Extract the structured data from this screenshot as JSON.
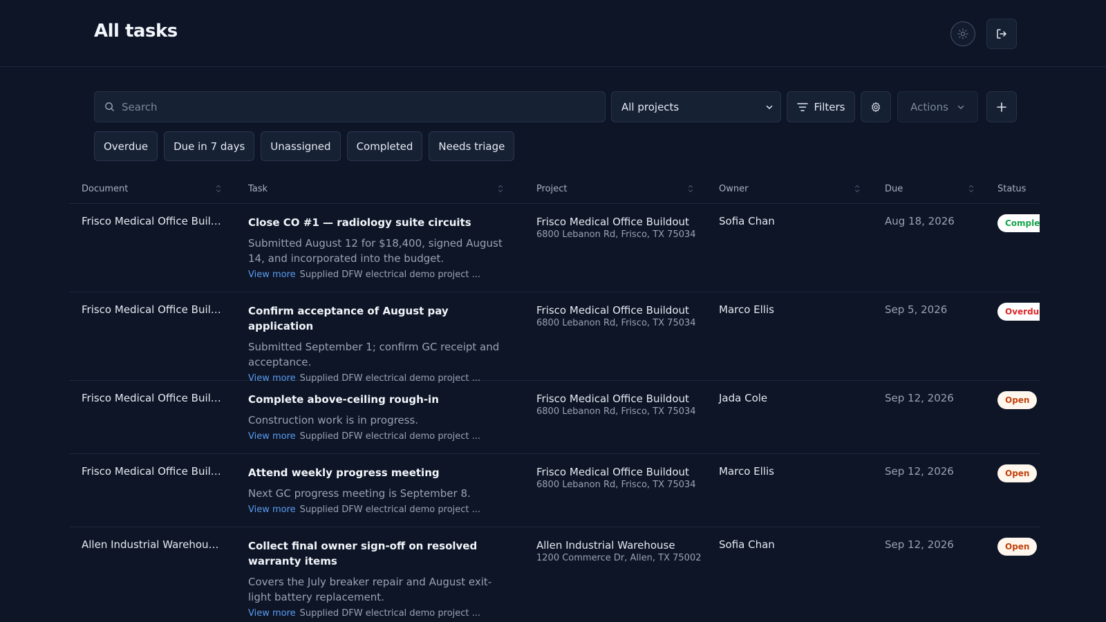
{
  "header": {
    "title": "All tasks",
    "theme_icon": "sun-icon",
    "logout_icon": "logout-icon"
  },
  "toolbar": {
    "search_placeholder": "Search",
    "project_select_value": "All projects",
    "filters_label": "Filters",
    "actions_label": "Actions",
    "settings_icon": "gear-icon",
    "add_icon": "plus-icon"
  },
  "chips": [
    "Overdue",
    "Due in 7 days",
    "Unassigned",
    "Completed",
    "Needs triage"
  ],
  "table": {
    "columns": {
      "document": "Document",
      "task": "Task",
      "project": "Project",
      "owner": "Owner",
      "due": "Due",
      "status": "Status"
    },
    "view_more_label": "View more",
    "rows": [
      {
        "document": "Frisco Medical Office Buildo...",
        "task_title": "Close CO #1 — radiology suite circuits",
        "task_desc": "Submitted August 12 for $18,400, signed August 14, and incorporated into the budget.",
        "source": "Supplied DFW electrical demo project ...",
        "project_name": "Frisco Medical Office Buildout",
        "project_address": "6800 Lebanon Rd, Frisco, TX 75034",
        "owner": "Sofia Chan",
        "due": "Aug 18, 2026",
        "status": "Complete",
        "status_kind": "complete"
      },
      {
        "document": "Frisco Medical Office Buildo...",
        "task_title": "Confirm acceptance of August pay application",
        "task_desc": "Submitted September 1; confirm GC receipt and acceptance.",
        "source": "Supplied DFW electrical demo project ...",
        "project_name": "Frisco Medical Office Buildout",
        "project_address": "6800 Lebanon Rd, Frisco, TX 75034",
        "owner": "Marco Ellis",
        "due": "Sep 5, 2026",
        "status": "Overdue",
        "status_kind": "overdue"
      },
      {
        "document": "Frisco Medical Office Buildo...",
        "task_title": "Complete above-ceiling rough-in",
        "task_desc": "Construction work is in progress.",
        "source": "Supplied DFW electrical demo project ...",
        "project_name": "Frisco Medical Office Buildout",
        "project_address": "6800 Lebanon Rd, Frisco, TX 75034",
        "owner": "Jada Cole",
        "due": "Sep 12, 2026",
        "status": "Open",
        "status_kind": "open"
      },
      {
        "document": "Frisco Medical Office Buildo...",
        "task_title": "Attend weekly progress meeting",
        "task_desc": "Next GC progress meeting is September 8.",
        "source": "Supplied DFW electrical demo project ...",
        "project_name": "Frisco Medical Office Buildout",
        "project_address": "6800 Lebanon Rd, Frisco, TX 75034",
        "owner": "Marco Ellis",
        "due": "Sep 12, 2026",
        "status": "Open",
        "status_kind": "open"
      },
      {
        "document": "Allen Industrial Warehouse ...",
        "task_title": "Collect final owner sign-off on resolved warranty items",
        "task_desc": "Covers the July breaker repair and August exit-light battery replacement.",
        "source": "Supplied DFW electrical demo project ...",
        "project_name": "Allen Industrial Warehouse",
        "project_address": "1200 Commerce Dr, Allen, TX 75002",
        "owner": "Sofia Chan",
        "due": "Sep 12, 2026",
        "status": "Open",
        "status_kind": "open"
      }
    ]
  }
}
